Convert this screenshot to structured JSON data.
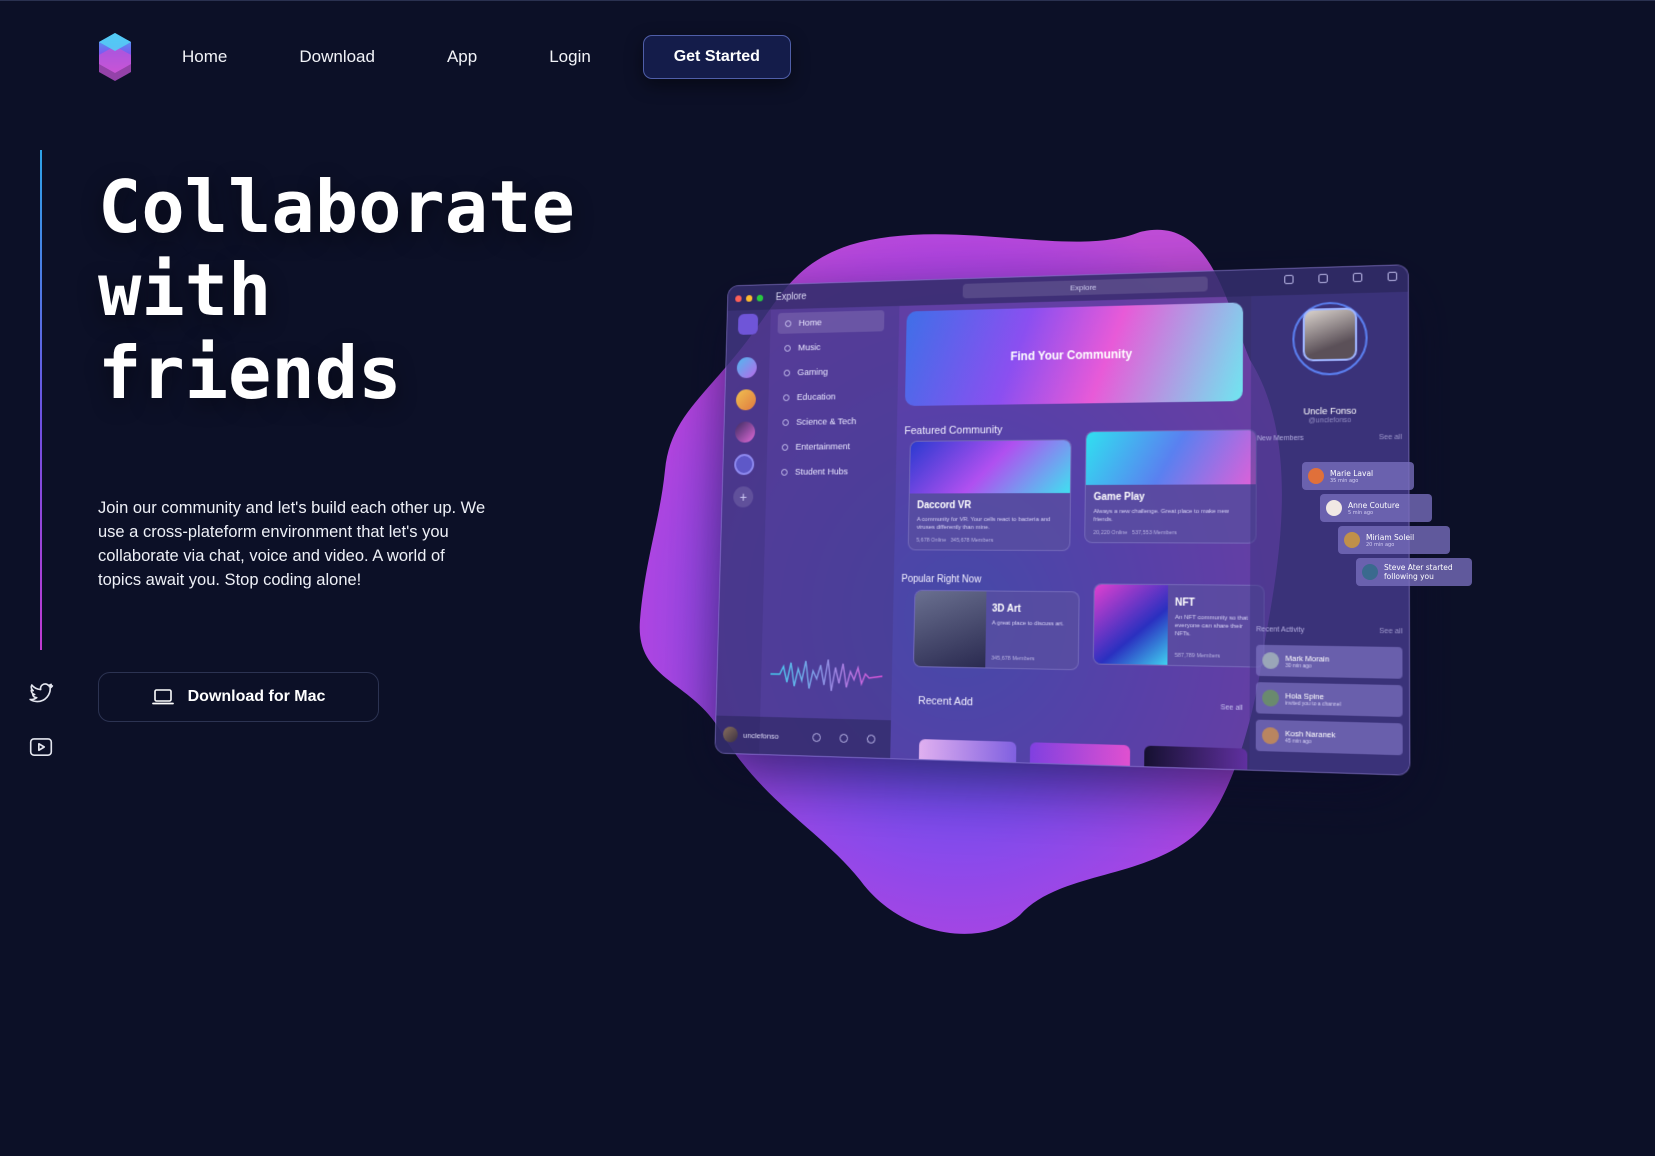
{
  "nav": {
    "links": [
      "Home",
      "Download",
      "App",
      "Login"
    ],
    "cta_label": "Get Started"
  },
  "hero": {
    "title_lines": [
      "Collaborate",
      "with",
      "friends"
    ],
    "description": "Join our community and let's build each other up. We use a cross-plateform environment that let's you collaborate via chat, voice and video. A world of topics await you. Stop coding alone!",
    "download_label": "Download for Mac",
    "download_icon": "laptop-icon"
  },
  "social": {
    "twitter_icon": "twitter-icon",
    "youtube_icon": "youtube-icon"
  },
  "colors": {
    "background": "#0c1027",
    "cta_bg": "#141c4a",
    "accent_blue": "#2ea3e8",
    "accent_purple": "#8b4ff0",
    "accent_pink": "#e85ad8"
  },
  "mockup": {
    "window_title": "Explore",
    "search_placeholder": "Explore",
    "sidebar": [
      "Home",
      "Music",
      "Gaming",
      "Education",
      "Science & Tech",
      "Entertainment",
      "Student Hubs"
    ],
    "user_handle": "unclefonso",
    "banner": "Find Your Community",
    "featured_heading": "Featured Community",
    "featured": [
      {
        "title": "Daccord VR",
        "desc": "A community for VR. Your cells react to bacteria and viruses differently than mine.",
        "online": "5,678 Online",
        "members": "345,678 Members"
      },
      {
        "title": "Game Play",
        "desc": "Always a new challenge. Great place to make new friends.",
        "online": "20,220 Online",
        "members": "537,553 Members"
      }
    ],
    "popular_heading": "Popular Right Now",
    "popular": [
      {
        "title": "3D Art",
        "desc": "A great place to discuss art.",
        "members": "345,678 Members"
      },
      {
        "title": "NFT",
        "desc": "An NFT community so that everyone can share their NFTs.",
        "members": "587,789 Members"
      }
    ],
    "recent_heading": "Recent Add",
    "recent_see_all": "See all",
    "profile": {
      "name": "Uncle Fonso",
      "handle": "@unclefonso"
    },
    "new_members_label": "New Members",
    "new_members_see_all": "See all",
    "new_members": [
      {
        "name": "Marie Laval",
        "time": "35 min ago"
      },
      {
        "name": "Anne Couture",
        "time": "5 min ago"
      },
      {
        "name": "Miriam Soleil",
        "time": "20 min ago"
      },
      {
        "name": "Steve Ater started following you",
        "time": ""
      }
    ],
    "activity_label": "Recent Activity",
    "activity_see_all": "See all",
    "activity": [
      {
        "name": "Mark Morain",
        "note": "30 min ago"
      },
      {
        "name": "Hola Spine",
        "note": "invited you to a channel"
      },
      {
        "name": "Kosh Naranek",
        "note": "45 min ago"
      }
    ]
  }
}
